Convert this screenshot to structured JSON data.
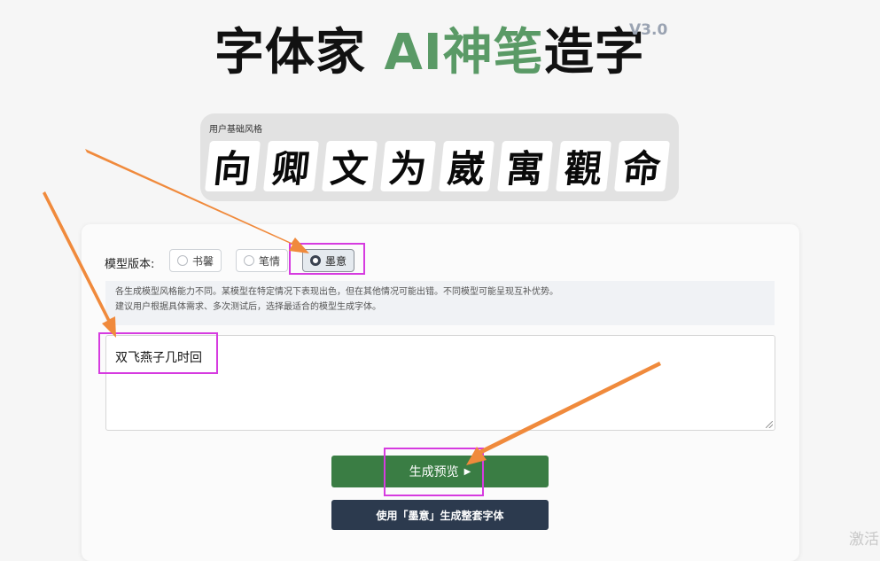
{
  "header": {
    "title_part1": "字体家 ",
    "title_highlight": "AI神笔",
    "title_part2": "造字",
    "version": "V3.0"
  },
  "style_panel": {
    "label": "用户基础风格",
    "samples": [
      "向",
      "卿",
      "文",
      "为",
      "崴",
      "寓",
      "觀",
      "命"
    ]
  },
  "model": {
    "label": "模型版本:",
    "options": [
      "书馨",
      "笔情",
      "墨意"
    ],
    "selected": "墨意"
  },
  "description": {
    "line1": "各生成模型风格能力不同。某模型在特定情况下表现出色，但在其他情况可能出错。不同模型可能呈现互补优势。",
    "line2": "建议用户根据具体需求、多次测试后，选择最适合的模型生成字体。"
  },
  "input": {
    "value": "双飞燕子几时回"
  },
  "buttons": {
    "generate_preview": "生成预览",
    "generate_full": "使用「墨意」生成整套字体"
  },
  "colors": {
    "accent_green": "#5a9a66",
    "button_green": "#3a7d44",
    "button_dark": "#2c3a4e",
    "highlight_box": "#d63be0",
    "arrow": "#f08a3c"
  },
  "watermark": "激活"
}
